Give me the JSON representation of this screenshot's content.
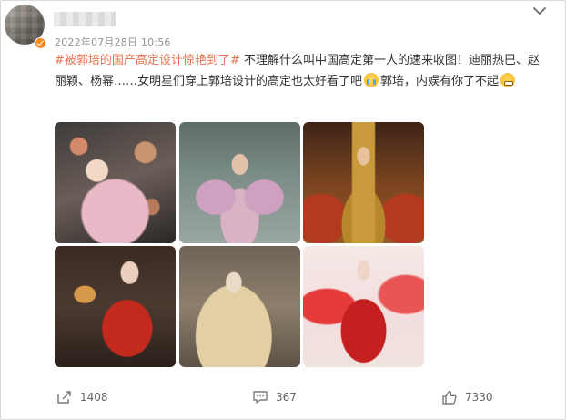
{
  "post": {
    "timestamp": "2022年07月28日 10:56",
    "hashtag": "#被郭培的国产高定设计惊艳到了#",
    "body_part1": "不理解什么叫中国高定第一人的速来收图！迪丽热巴、赵丽颖、杨幂……女明星们穿上郭培设计的高定也太好看了吧",
    "body_part2": "郭培，内娱有你了不起",
    "emojis": [
      "crying-emoji",
      "grimace-emoji"
    ],
    "accent_color": "#eb7350"
  },
  "photos": [
    {
      "name": "photo-1"
    },
    {
      "name": "photo-2"
    },
    {
      "name": "photo-3"
    },
    {
      "name": "photo-4"
    },
    {
      "name": "photo-5"
    },
    {
      "name": "photo-6"
    }
  ],
  "actions": {
    "share_count": "1408",
    "comment_count": "367",
    "like_count": "7330"
  },
  "icons": {
    "more": "chevron-down-icon",
    "share": "share-icon",
    "comment": "comment-icon",
    "like": "thumbs-up-icon",
    "verified": "verified-badge-icon"
  }
}
